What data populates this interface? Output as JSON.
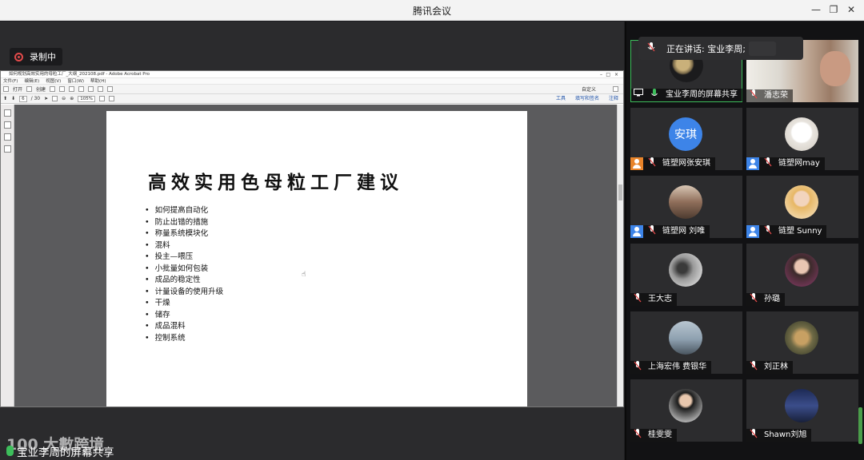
{
  "window": {
    "title": "腾讯会议"
  },
  "recording": {
    "label": "录制中"
  },
  "acrobat": {
    "title": "如何规划高效实用的母粒工厂_大纲_202108.pdf - Adobe Acrobat Pro",
    "menu": [
      "文件(F)",
      "编辑(E)",
      "视图(V)",
      "窗口(W)",
      "帮助(H)"
    ],
    "toolbar": {
      "open": "打开",
      "create": "创建",
      "customize": "自定义",
      "page": "6",
      "page_total": "/ 30",
      "zoom": "105%"
    },
    "right_links": [
      "工具",
      "填写和签名",
      "注释"
    ]
  },
  "slide": {
    "title": "高效实用色母粒工厂建议",
    "bullets": [
      "如何提高自动化",
      "防止出错的措施",
      "称量系统模块化",
      "混料",
      "投主—喂压",
      "小批量如何包装",
      "成品的稳定性",
      "计量设备的使用升级",
      "干燥",
      "储存",
      "成品混料",
      "控制系统"
    ]
  },
  "speaking": {
    "label": "正在讲话: 宝业李周;"
  },
  "participants": [
    {
      "name": "宝业李周的屏幕共享",
      "badge": "screen",
      "avatar": "moon"
    },
    {
      "name": "潘志荣",
      "badge": "mic",
      "avatar": "video"
    },
    {
      "name": "链塑网张安琪",
      "badge": "user-orange",
      "avatar": "text",
      "avatar_text": "安琪"
    },
    {
      "name": "链塑网may",
      "badge": "user",
      "avatar": "cat"
    },
    {
      "name": "链塑网 刘唯",
      "badge": "user",
      "avatar": "photo-warm"
    },
    {
      "name": "链塑 Sunny",
      "badge": "user",
      "avatar": "girl"
    },
    {
      "name": "王大志",
      "badge": "mic",
      "avatar": "ink"
    },
    {
      "name": "孙璐",
      "badge": "mic",
      "avatar": "woman"
    },
    {
      "name": "上海宏伟 费银华",
      "badge": "mic",
      "avatar": "sky"
    },
    {
      "name": "刘正林",
      "badge": "mic",
      "avatar": "bird"
    },
    {
      "name": "桂雯雯",
      "badge": "mic",
      "avatar": "man"
    },
    {
      "name": "Shawn刘旭",
      "badge": "mic",
      "avatar": "night"
    }
  ],
  "share_bar": {
    "label": "宝业李周的屏幕共享"
  },
  "watermark": {
    "text": "100 大數跨境"
  },
  "colors": {
    "accent": "#3d84e8",
    "record": "#e24a4a",
    "mic": "#3dbe5b",
    "orange": "#e8842a"
  }
}
